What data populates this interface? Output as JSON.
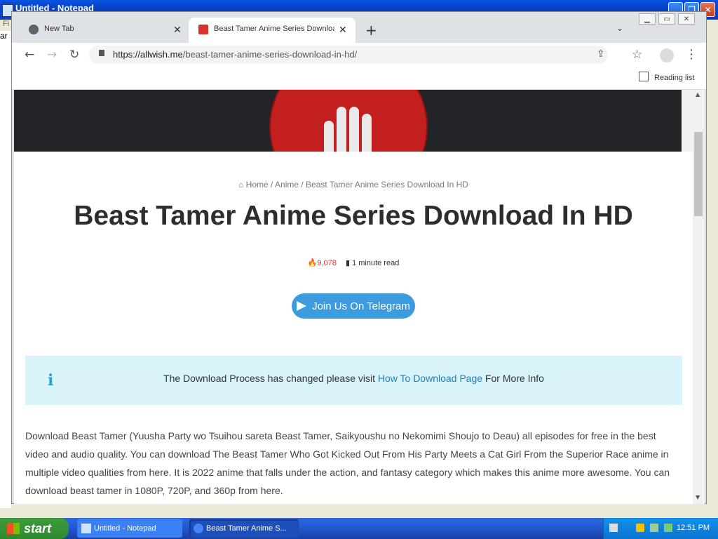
{
  "notepad": {
    "title": "Untitled - Notepad",
    "menu_first": "Fi",
    "body_text": "ar"
  },
  "browser": {
    "tabs": [
      {
        "label": "New Tab"
      },
      {
        "label": "Beast Tamer Anime Series Download In HD"
      }
    ],
    "url_host": "https://allwish.me",
    "url_path": "/beast-tamer-anime-series-download-in-hd/",
    "reading_list": "Reading list"
  },
  "page": {
    "breadcrumb": {
      "home": "Home",
      "sep1": " / ",
      "anime": "Anime",
      "sep2": " / ",
      "current": "Beast Tamer Anime Series Download In HD"
    },
    "title": "Beast Tamer Anime Series Download In HD",
    "views": "9,078",
    "read_time": "1 minute read",
    "telegram_button": "Join Us On Telegram",
    "notice": {
      "before": "The Download Process has changed please visit ",
      "link": "How To Download Page",
      "after": " For More Info",
      "icon": "i"
    },
    "article": "Download Beast Tamer (Yuusha Party wo Tsuihou sareta Beast Tamer, Saikyoushu no Nekomimi Shoujo to Deau) all episodes for free in the best video and audio quality. You can download The Beast Tamer Who Got Kicked Out From His Party Meets a Cat Girl From the Superior Race anime in multiple video qualities from here. It is 2022 anime that falls under the action, and fantasy category which makes this anime more awesome. You can download beast tamer in 1080P, 720P, and 360p from here."
  },
  "taskbar": {
    "start": "start",
    "tasks": [
      {
        "label": "Untitled - Notepad"
      },
      {
        "label": "Beast Tamer Anime S..."
      }
    ],
    "clock": "12:51 PM"
  },
  "colors": {
    "accent_telegram": "#3d9be0",
    "notice_bg": "#d8f3fa",
    "link": "#1e7fb5",
    "views_red": "#dd3333"
  }
}
